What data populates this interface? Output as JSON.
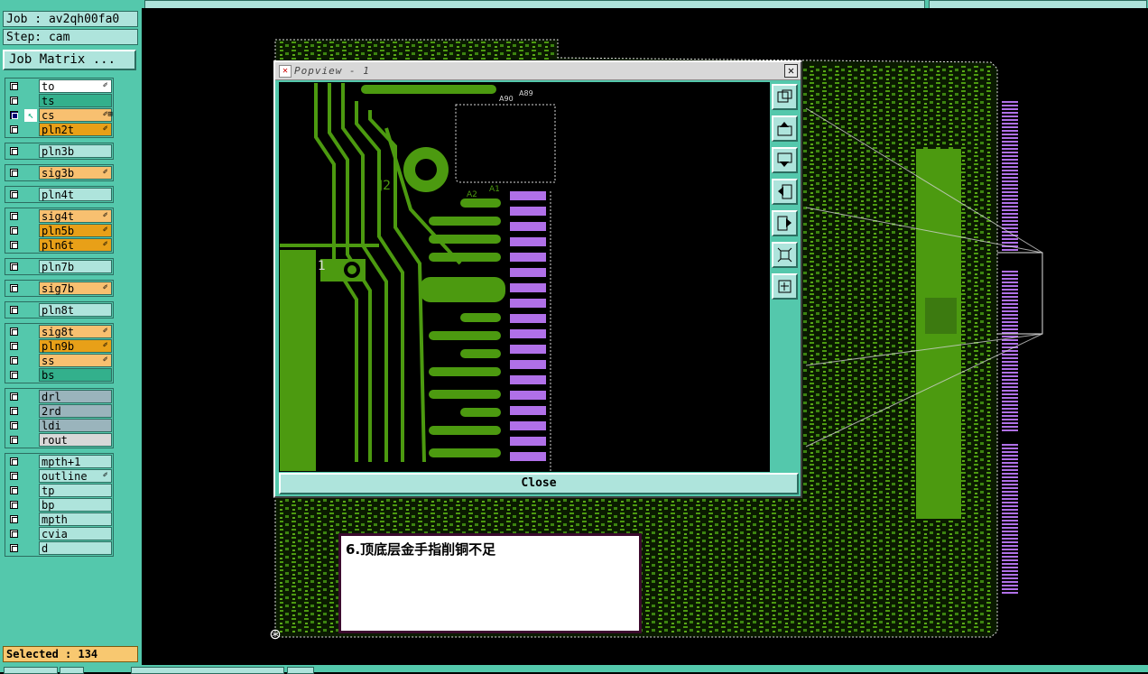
{
  "job_label": "Job : av2qh00fa0",
  "step_label": "Step: cam",
  "job_matrix_button": "Job Matrix ...",
  "selected_status": "Selected : 134",
  "layer_groups": [
    {
      "layers": [
        {
          "name": "to",
          "color": "#ffffff",
          "checked": false,
          "flag": "✐"
        },
        {
          "name": "ts",
          "color": "#33b08c",
          "checked": false,
          "flag": ""
        },
        {
          "name": "cs",
          "color": "#f8c070",
          "checked": true,
          "active": true,
          "flag": "✐⊞"
        },
        {
          "name": "pln2t",
          "color": "#e8a018",
          "checked": false,
          "flag": "✐"
        }
      ]
    },
    {
      "layers": [
        {
          "name": "pln3b",
          "color": "#aee4dc",
          "checked": false,
          "flag": ""
        }
      ]
    },
    {
      "layers": [
        {
          "name": "sig3b",
          "color": "#f8c070",
          "checked": false,
          "flag": "✐"
        }
      ]
    },
    {
      "layers": [
        {
          "name": "pln4t",
          "color": "#aee4dc",
          "checked": false,
          "flag": ""
        }
      ]
    },
    {
      "layers": [
        {
          "name": "sig4t",
          "color": "#f8c070",
          "checked": false,
          "flag": "✐"
        },
        {
          "name": "pln5b",
          "color": "#e8a018",
          "checked": false,
          "flag": "✐"
        },
        {
          "name": "pln6t",
          "color": "#e8a018",
          "checked": false,
          "flag": "✐"
        }
      ]
    },
    {
      "layers": [
        {
          "name": "pln7b",
          "color": "#aee4dc",
          "checked": false,
          "flag": ""
        }
      ]
    },
    {
      "layers": [
        {
          "name": "sig7b",
          "color": "#f8c070",
          "checked": false,
          "flag": "✐"
        }
      ]
    },
    {
      "layers": [
        {
          "name": "pln8t",
          "color": "#aee4dc",
          "checked": false,
          "flag": ""
        }
      ]
    },
    {
      "layers": [
        {
          "name": "sig8t",
          "color": "#f8c070",
          "checked": false,
          "flag": "✐"
        },
        {
          "name": "pln9b",
          "color": "#e8a018",
          "checked": false,
          "flag": "✐"
        },
        {
          "name": "ss",
          "color": "#f8c070",
          "checked": false,
          "flag": "✐"
        },
        {
          "name": "bs",
          "color": "#33b08c",
          "checked": false,
          "flag": ""
        }
      ]
    },
    {
      "layers": [
        {
          "name": "drl",
          "color": "#9ab4bc",
          "checked": false,
          "flag": ""
        },
        {
          "name": "2rd",
          "color": "#9ab4bc",
          "checked": false,
          "flag": ""
        },
        {
          "name": "ldi",
          "color": "#9ab4bc",
          "checked": false,
          "flag": ""
        },
        {
          "name": "rout",
          "color": "#d8d8d8",
          "checked": false,
          "flag": ""
        }
      ]
    },
    {
      "layers": [
        {
          "name": "mpth+1",
          "color": "#aee4dc",
          "checked": false,
          "flag": ""
        },
        {
          "name": "outline",
          "color": "#aee4dc",
          "checked": false,
          "flag": "✐"
        },
        {
          "name": "tp",
          "color": "#aee4dc",
          "checked": false,
          "flag": ""
        },
        {
          "name": "bp",
          "color": "#aee4dc",
          "checked": false,
          "flag": ""
        },
        {
          "name": "mpth",
          "color": "#aee4dc",
          "checked": false,
          "flag": ""
        },
        {
          "name": "cvia",
          "color": "#aee4dc",
          "checked": false,
          "flag": ""
        },
        {
          "name": "d",
          "color": "#aee4dc",
          "checked": false,
          "flag": ""
        }
      ]
    }
  ],
  "popview": {
    "title": "Popview - 1",
    "close_button": "Close",
    "tools": [
      "zoom-fit-icon",
      "move-up-icon",
      "move-down-icon",
      "move-left-icon",
      "move-right-icon",
      "zoom-in-icon",
      "zoom-out-icon"
    ],
    "view_labels": {
      "connector": "J2",
      "pin_a2": "A2",
      "pin_a1": "A1",
      "top_label": "A90",
      "top_label2": "A89",
      "pad_label": "1"
    }
  },
  "note_text": "6.顶底层金手指削铜不足",
  "colors": {
    "panel": "#54c8ac",
    "panel_light": "#aee4dc",
    "copper": "#4c9a10",
    "finger": "#b070e8",
    "selected_bg": "#f8c870"
  }
}
